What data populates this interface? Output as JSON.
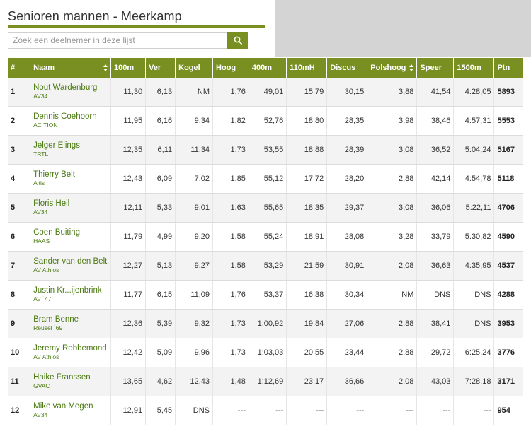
{
  "page": {
    "title": "Senioren mannen - Meerkamp",
    "search_placeholder": "Zoek een deelnemer in deze lijst"
  },
  "colors": {
    "accent": "#7a8f21",
    "link": "#4a7a10",
    "background": "#d4d4d4"
  },
  "icons": {
    "search": "search-icon",
    "sort": "sort-arrows-icon"
  },
  "columns": [
    "#",
    "Naam",
    "100m",
    "Ver",
    "Kogel",
    "Hoog",
    "400m",
    "110mH",
    "Discus",
    "Polshoog",
    "Speer",
    "1500m",
    "Ptn"
  ],
  "rows": [
    {
      "rank": "1",
      "name": "Nout Wardenburg",
      "club": "AV34",
      "c100m": "11,30",
      "ver": "6,13",
      "kogel": "NM",
      "hoog": "1,76",
      "c400m": "49,01",
      "c110mh": "15,79",
      "discus": "30,15",
      "polshoog": "3,88",
      "speer": "41,54",
      "c1500m": "4:28,05",
      "ptn": "5893"
    },
    {
      "rank": "2",
      "name": "Dennis Coehoorn",
      "club": "AC TION",
      "c100m": "11,95",
      "ver": "6,16",
      "kogel": "9,34",
      "hoog": "1,82",
      "c400m": "52,76",
      "c110mh": "18,80",
      "discus": "28,35",
      "polshoog": "3,98",
      "speer": "38,46",
      "c1500m": "4:57,31",
      "ptn": "5553"
    },
    {
      "rank": "3",
      "name": "Jelger Elings",
      "club": "TRTL",
      "c100m": "12,35",
      "ver": "6,11",
      "kogel": "11,34",
      "hoog": "1,73",
      "c400m": "53,55",
      "c110mh": "18,88",
      "discus": "28,39",
      "polshoog": "3,08",
      "speer": "36,52",
      "c1500m": "5:04,24",
      "ptn": "5167"
    },
    {
      "rank": "4",
      "name": "Thierry Belt",
      "club": "Altis",
      "c100m": "12,43",
      "ver": "6,09",
      "kogel": "7,02",
      "hoog": "1,85",
      "c400m": "55,12",
      "c110mh": "17,72",
      "discus": "28,20",
      "polshoog": "2,88",
      "speer": "42,14",
      "c1500m": "4:54,78",
      "ptn": "5118"
    },
    {
      "rank": "5",
      "name": "Floris Heil",
      "club": "AV34",
      "c100m": "12,11",
      "ver": "5,33",
      "kogel": "9,01",
      "hoog": "1,63",
      "c400m": "55,65",
      "c110mh": "18,35",
      "discus": "29,37",
      "polshoog": "3,08",
      "speer": "36,06",
      "c1500m": "5:22,11",
      "ptn": "4706"
    },
    {
      "rank": "6",
      "name": "Coen Buiting",
      "club": "HAAS",
      "c100m": "11,79",
      "ver": "4,99",
      "kogel": "9,20",
      "hoog": "1,58",
      "c400m": "55,24",
      "c110mh": "18,91",
      "discus": "28,08",
      "polshoog": "3,28",
      "speer": "33,79",
      "c1500m": "5:30,82",
      "ptn": "4590"
    },
    {
      "rank": "7",
      "name": "Sander van den Belt",
      "club": "AV Athlos",
      "c100m": "12,27",
      "ver": "5,13",
      "kogel": "9,27",
      "hoog": "1,58",
      "c400m": "53,29",
      "c110mh": "21,59",
      "discus": "30,91",
      "polshoog": "2,08",
      "speer": "36,63",
      "c1500m": "4:35,95",
      "ptn": "4537"
    },
    {
      "rank": "8",
      "name": "Justin Kr...ijenbrink",
      "club": "AV `47",
      "c100m": "11,77",
      "ver": "6,15",
      "kogel": "11,09",
      "hoog": "1,76",
      "c400m": "53,37",
      "c110mh": "16,38",
      "discus": "30,34",
      "polshoog": "NM",
      "speer": "DNS",
      "c1500m": "DNS",
      "ptn": "4288"
    },
    {
      "rank": "9",
      "name": "Bram Benne",
      "club": "Reusel `69",
      "c100m": "12,36",
      "ver": "5,39",
      "kogel": "9,32",
      "hoog": "1,73",
      "c400m": "1:00,92",
      "c110mh": "19,84",
      "discus": "27,06",
      "polshoog": "2,88",
      "speer": "38,41",
      "c1500m": "DNS",
      "ptn": "3953"
    },
    {
      "rank": "10",
      "name": "Jeremy Robbemond",
      "club": "AV Athlos",
      "c100m": "12,42",
      "ver": "5,09",
      "kogel": "9,96",
      "hoog": "1,73",
      "c400m": "1:03,03",
      "c110mh": "20,55",
      "discus": "23,44",
      "polshoog": "2,88",
      "speer": "29,72",
      "c1500m": "6:25,24",
      "ptn": "3776"
    },
    {
      "rank": "11",
      "name": "Haike Franssen",
      "club": "GVAC",
      "c100m": "13,65",
      "ver": "4,62",
      "kogel": "12,43",
      "hoog": "1,48",
      "c400m": "1:12,69",
      "c110mh": "23,17",
      "discus": "36,66",
      "polshoog": "2,08",
      "speer": "43,03",
      "c1500m": "7:28,18",
      "ptn": "3171"
    },
    {
      "rank": "12",
      "name": "Mike van Megen",
      "club": "AV34",
      "c100m": "12,91",
      "ver": "5,45",
      "kogel": "DNS",
      "hoog": "---",
      "c400m": "---",
      "c110mh": "---",
      "discus": "---",
      "polshoog": "---",
      "speer": "---",
      "c1500m": "---",
      "ptn": "954"
    }
  ]
}
